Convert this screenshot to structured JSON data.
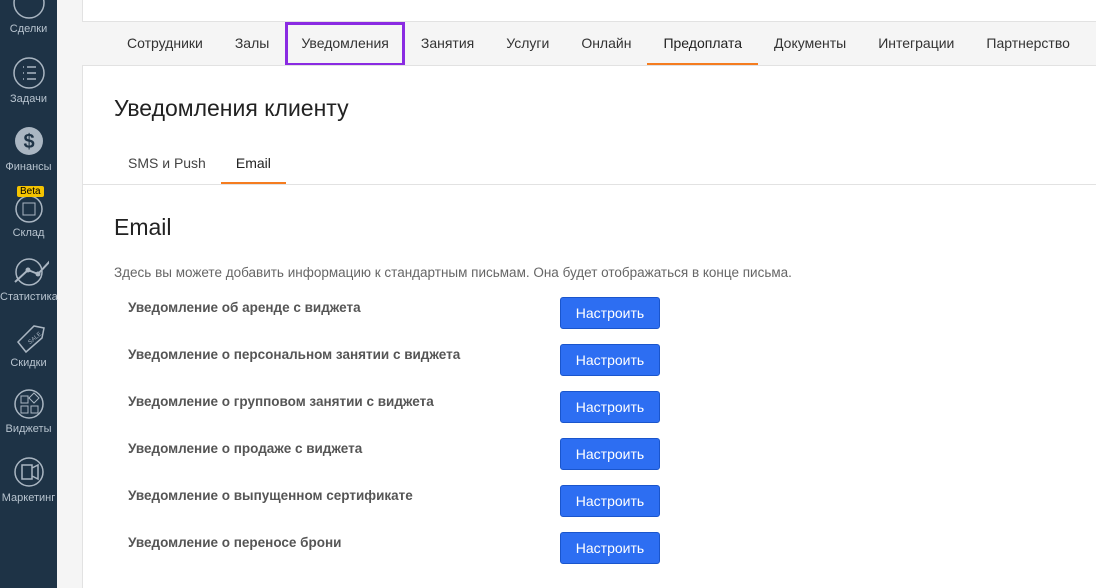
{
  "sidebar": {
    "items": [
      {
        "label": "Сделки",
        "icon": "handshake-icon"
      },
      {
        "label": "Задачи",
        "icon": "tasks-icon"
      },
      {
        "label": "Финансы",
        "icon": "dollar-icon"
      },
      {
        "label": "Склад",
        "icon": "box-icon",
        "badge": "Beta"
      },
      {
        "label": "Статистика",
        "icon": "chart-icon"
      },
      {
        "label": "Скидки",
        "icon": "sale-tag-icon"
      },
      {
        "label": "Виджеты",
        "icon": "widgets-icon"
      },
      {
        "label": "Маркетинг",
        "icon": "megaphone-icon"
      }
    ]
  },
  "tabs": [
    "Сотрудники",
    "Залы",
    "Уведомления",
    "Занятия",
    "Услуги",
    "Онлайн",
    "Предоплата",
    "Документы",
    "Интеграции",
    "Партнерство"
  ],
  "page_title": "Уведомления клиенту",
  "subtabs": [
    "SMS и Push",
    "Email"
  ],
  "section_title": "Email",
  "description": "Здесь вы можете добавить информацию к стандартным письмам. Она будет отображаться в конце письма.",
  "button_label": "Настроить",
  "notifications": [
    "Уведомление об аренде с виджета",
    "Уведомление о персональном занятии с виджета",
    "Уведомление о групповом занятии с виджета",
    "Уведомление о продаже с виджета",
    "Уведомление о выпущенном сертификате",
    "Уведомление о переносе брони"
  ],
  "colors": {
    "sidebar": "#1e3346",
    "accent": "#f57c1f",
    "button": "#2d6ef2",
    "highlight": "#8a2be2"
  }
}
